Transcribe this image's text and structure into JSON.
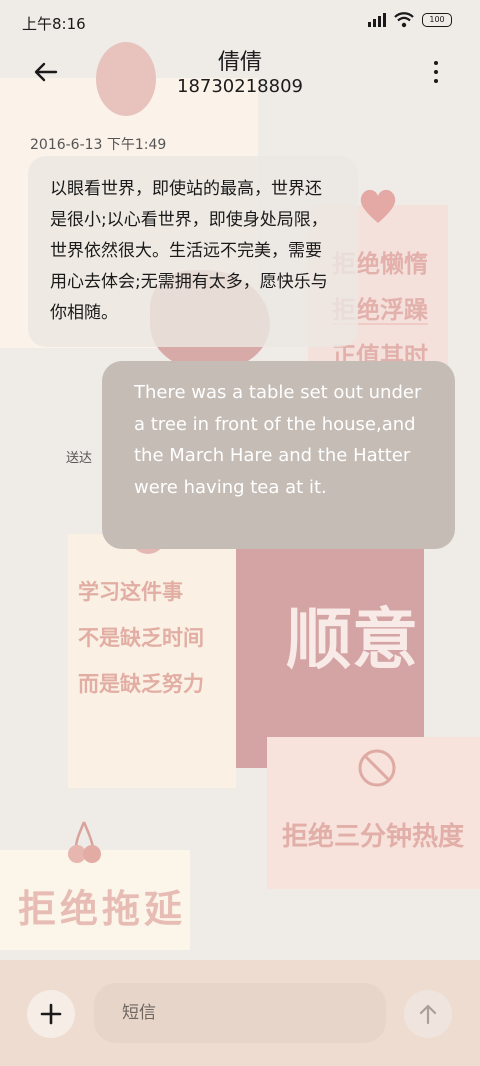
{
  "status_bar": {
    "time": "上午8:16",
    "battery": "100",
    "icons": [
      "signal-icon",
      "wifi-icon",
      "battery-icon"
    ]
  },
  "header": {
    "contact_name": "倩倩",
    "phone": "18730218809",
    "back_icon": "arrow-left-icon",
    "more_icon": "more-vertical-icon"
  },
  "messages": {
    "timestamp": "2016-6-13 下午1:49",
    "received": "以眼看世界，即使站的最高，世界还是很小;以心看世界，即使身处局限，世界依然很大。生活远不完美，需要用心去体会;无需拥有太多，愿快乐与你相随。",
    "sent_status": "送达",
    "sent": "There was a table set out under a tree in front of the house,and the March Hare and the Hatter were having tea at it."
  },
  "wallpaper": {
    "right_lines": [
      "拒绝懒惰",
      "拒绝浮躁",
      "正值其时"
    ],
    "mid_lines": [
      "学习这件事",
      "不是缺乏时间",
      "而是缺乏努力"
    ],
    "big_word": "顺意",
    "three_minutes": "拒绝三分钟热度",
    "delay": "拒绝拖延",
    "colors": {
      "pink": "#d4a3a4",
      "cream": "#fbf3ea",
      "blush": "#e3b1ac"
    }
  },
  "composer": {
    "add_icon": "plus-icon",
    "placeholder": "短信",
    "send_icon": "arrow-up-icon"
  }
}
